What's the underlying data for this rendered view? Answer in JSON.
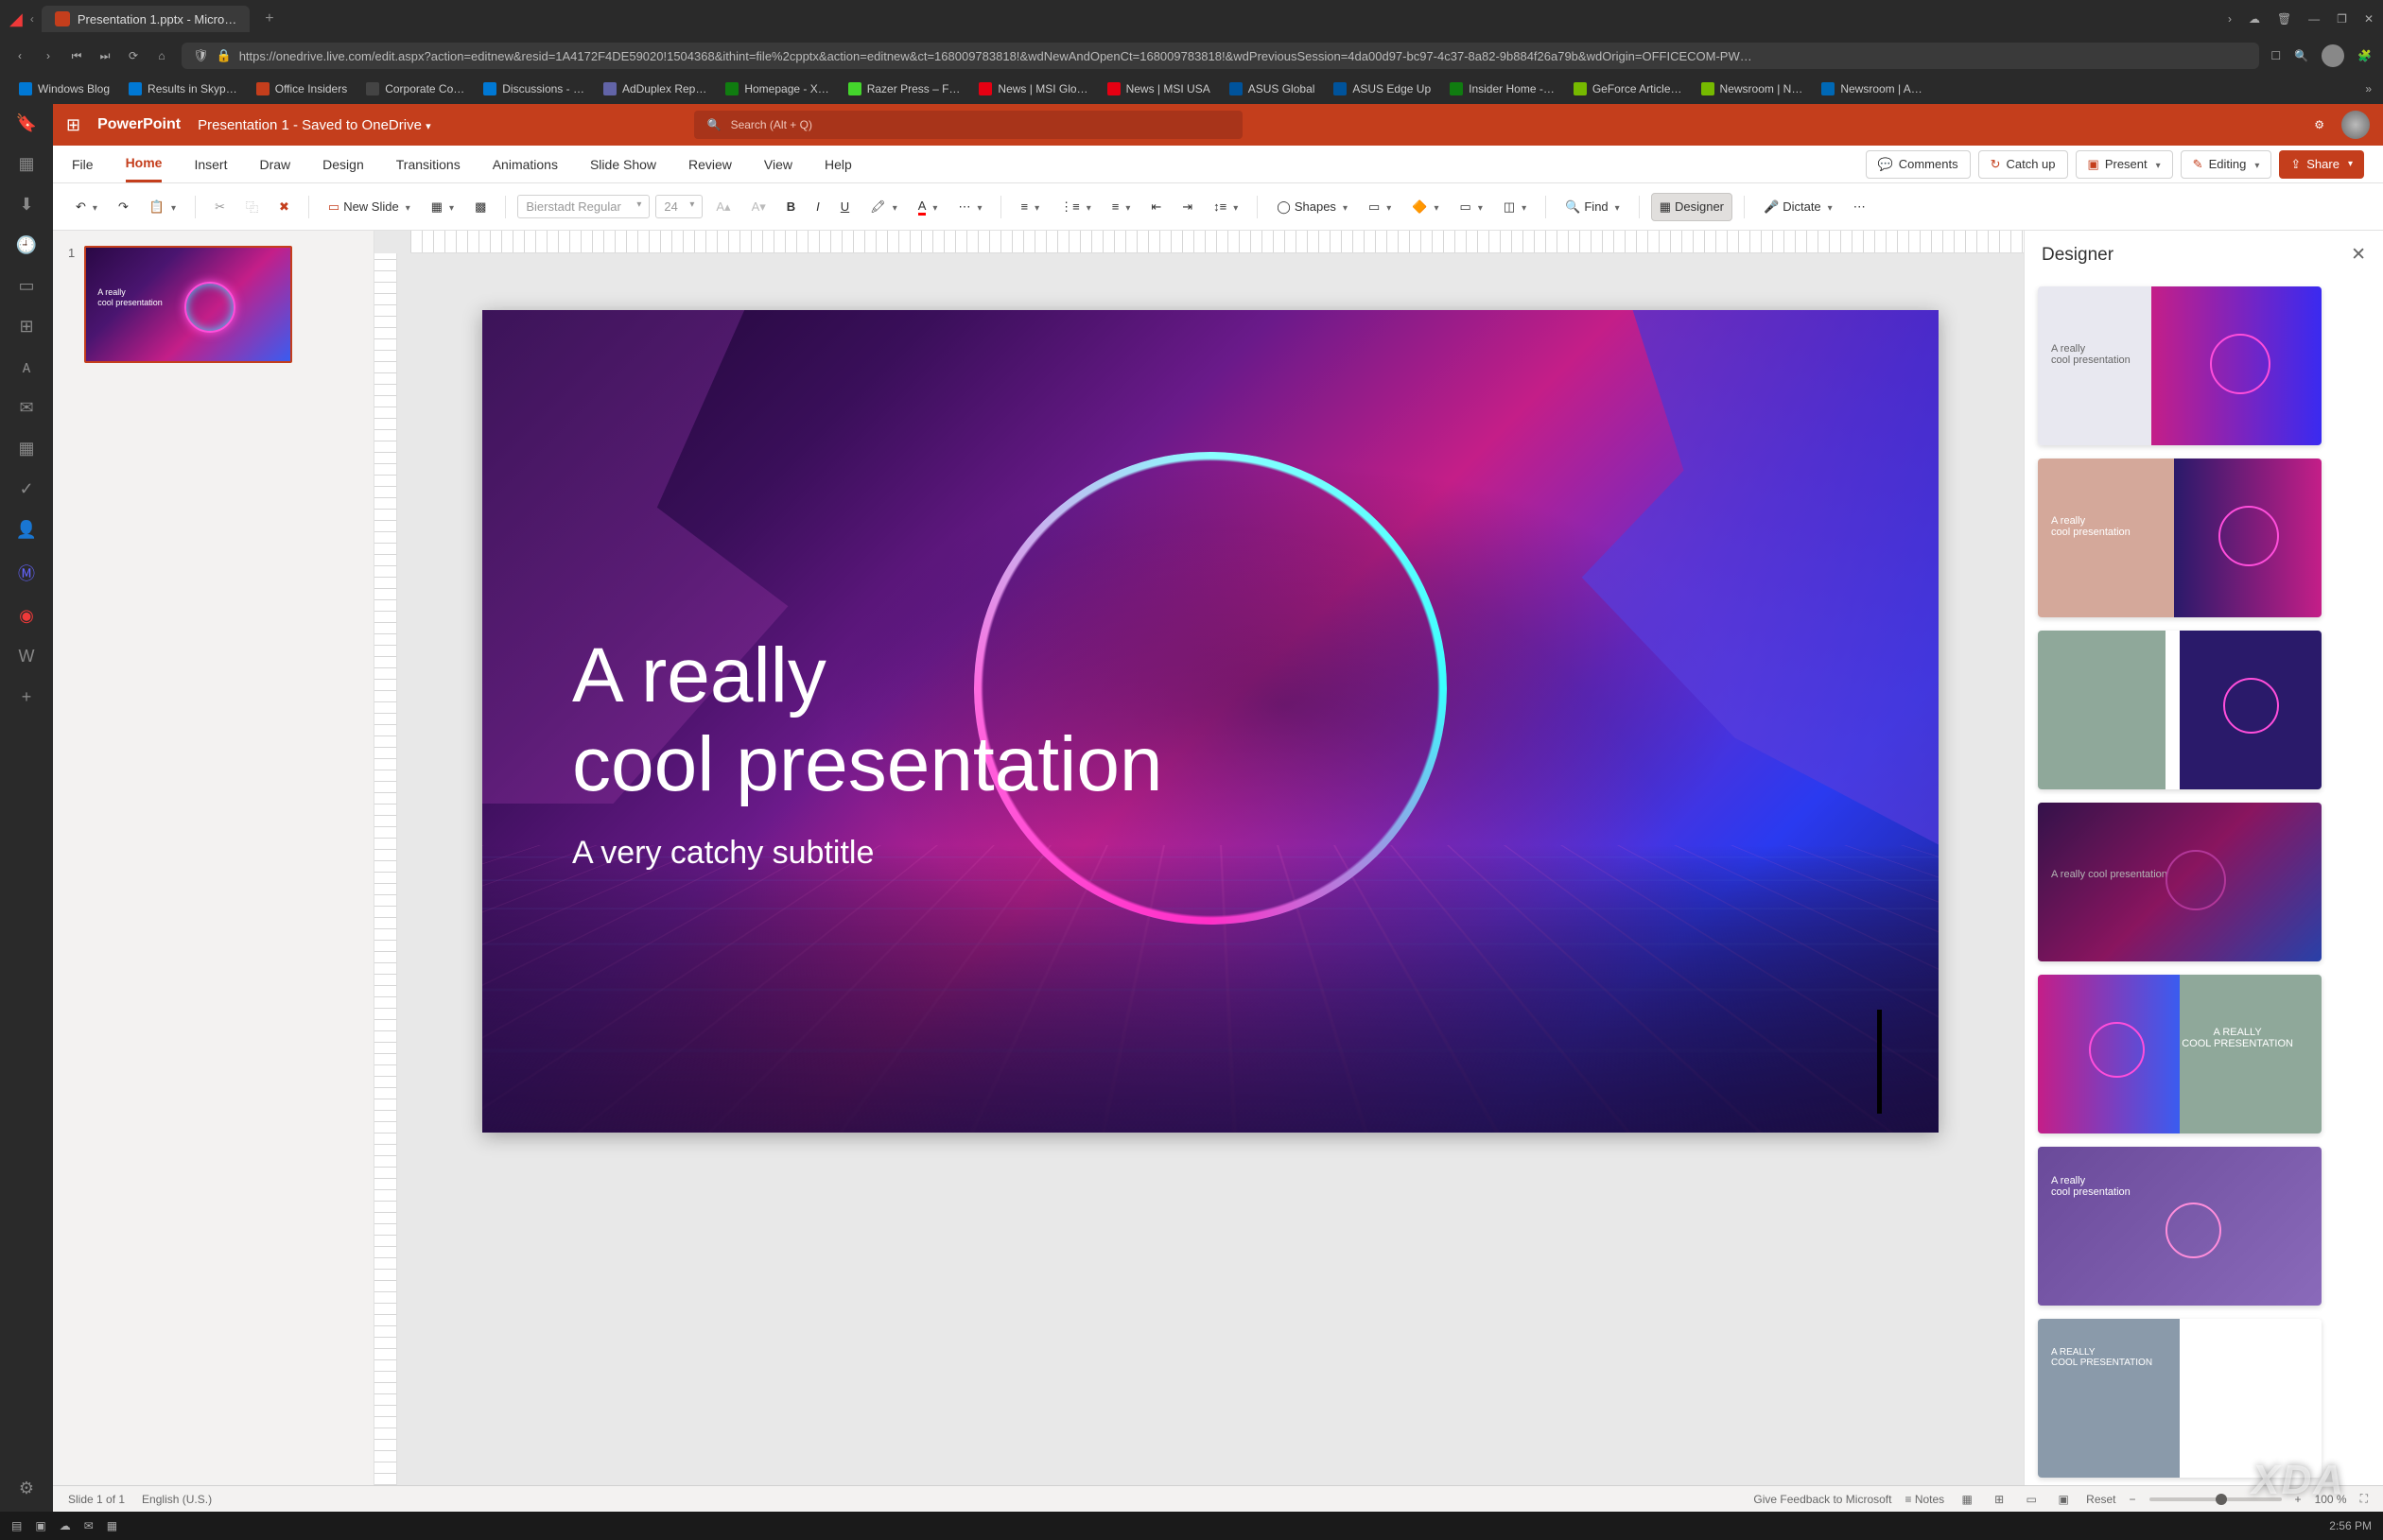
{
  "browser": {
    "tab_title": "Presentation 1.pptx - Micro…",
    "url": "https://onedrive.live.com/edit.aspx?action=editnew&resid=1A4172F4DE59020!1504368&ithint=file%2cpptx&action=editnew&ct=168009783818!&wdNewAndOpenCt=168009783818!&wdPreviousSession=4da00d97-bc97-4c37-8a82-9b884f26a79b&wdOrigin=OFFICECOM-PW…",
    "bookmarks": [
      {
        "label": "Windows Blog",
        "color": "#0078d4"
      },
      {
        "label": "Results in Skyp…",
        "color": "#0078d4"
      },
      {
        "label": "Office Insiders",
        "color": "#c43e1c"
      },
      {
        "label": "Corporate Co…",
        "color": "#444"
      },
      {
        "label": "Discussions - …",
        "color": "#0078d4"
      },
      {
        "label": "AdDuplex Rep…",
        "color": "#6264a7"
      },
      {
        "label": "Homepage - X…",
        "color": "#107c10"
      },
      {
        "label": "Razer Press – F…",
        "color": "#44d62c"
      },
      {
        "label": "News | MSI Glo…",
        "color": "#e60012"
      },
      {
        "label": "News | MSI USA",
        "color": "#e60012"
      },
      {
        "label": "ASUS Global",
        "color": "#00539b"
      },
      {
        "label": "ASUS Edge Up",
        "color": "#00539b"
      },
      {
        "label": "Insider Home -…",
        "color": "#107c10"
      },
      {
        "label": "GeForce Article…",
        "color": "#76b900"
      },
      {
        "label": "Newsroom | N…",
        "color": "#76b900"
      },
      {
        "label": "Newsroom | A…",
        "color": "#0068b5"
      }
    ]
  },
  "app": {
    "name": "PowerPoint",
    "doc_title": "Presentation 1",
    "doc_status": "- Saved to OneDrive",
    "search_placeholder": "Search (Alt + Q)"
  },
  "ribbon": {
    "tabs": [
      "File",
      "Home",
      "Insert",
      "Draw",
      "Design",
      "Transitions",
      "Animations",
      "Slide Show",
      "Review",
      "View",
      "Help"
    ],
    "active_tab": "Home",
    "actions": {
      "comments": "Comments",
      "catchup": "Catch up",
      "present": "Present",
      "editing": "Editing",
      "share": "Share"
    },
    "toolbar": {
      "new_slide": "New Slide",
      "font_name": "Bierstadt Regular",
      "font_size": "24",
      "shapes": "Shapes",
      "find": "Find",
      "designer": "Designer",
      "dictate": "Dictate"
    }
  },
  "slide_panel": {
    "thumb_number": "1",
    "thumb_title": "A really\ncool presentation"
  },
  "slide": {
    "title_line1": "A really",
    "title_line2": "cool presentation",
    "subtitle": "A very catchy subtitle"
  },
  "designer": {
    "title": "Designer",
    "options": [
      {
        "text1": "A really",
        "text2": "cool presentation"
      },
      {
        "text1": "A really",
        "text2": "cool presentation"
      },
      {
        "text1": "",
        "text2": ""
      },
      {
        "text1": "A really cool presentation",
        "text2": ""
      },
      {
        "text1": "A REALLY",
        "text2": "COOL PRESENTATION"
      },
      {
        "text1": "A really",
        "text2": "cool presentation"
      },
      {
        "text1": "A REALLY",
        "text2": "COOL PRESENTATION"
      }
    ]
  },
  "status": {
    "slide_info": "Slide 1 of 1",
    "language": "English (U.S.)",
    "feedback": "Give Feedback to Microsoft",
    "notes": "Notes",
    "zoom_reset": "Reset",
    "zoom_pct": "100 %"
  },
  "os": {
    "time": "2:56 PM"
  },
  "watermark": "XDA"
}
